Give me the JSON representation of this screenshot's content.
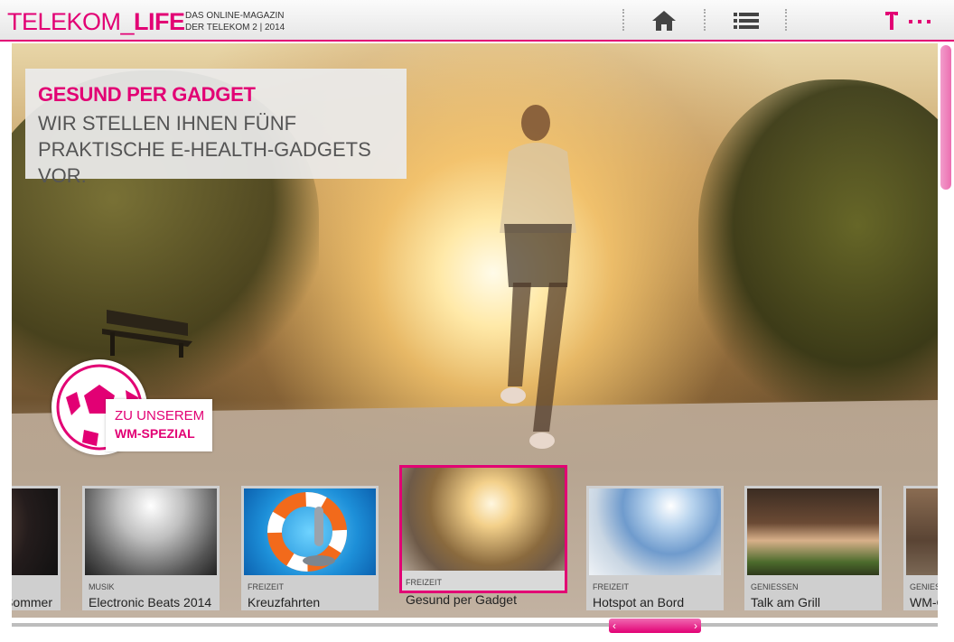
{
  "header": {
    "logo_left": "TELEKOM_",
    "logo_right": "LIFE",
    "tagline_line1": "DAS ONLINE-MAGAZIN",
    "tagline_line2": "DER TELEKOM 2 | 2014",
    "home_icon": "home-icon",
    "menu_icon": "list-icon",
    "brand_icon": "telekom-t-logo"
  },
  "hero": {
    "title": "GESUND PER GADGET",
    "subtitle": "WIR STELLEN IHNEN FÜNF PRAKTISCHE E-HEALTH-GADGETS VOR."
  },
  "wm_badge": {
    "line1": "ZU UNSEREM",
    "line2": "WM-SPEZIAL"
  },
  "thumbnails": [
    {
      "category": "",
      "title": "Sommer"
    },
    {
      "category": "MUSIK",
      "title": "Electronic Beats 2014"
    },
    {
      "category": "FREIZEIT",
      "title": "Kreuzfahrten"
    },
    {
      "category": "FREIZEIT",
      "title": "Gesund per Gadget"
    },
    {
      "category": "FREIZEIT",
      "title": "Hotspot an Bord"
    },
    {
      "category": "GENIESSEN",
      "title": "Talk am Grill"
    },
    {
      "category": "GENIES",
      "title": "WM-G"
    }
  ],
  "colors": {
    "accent": "#e20074"
  }
}
